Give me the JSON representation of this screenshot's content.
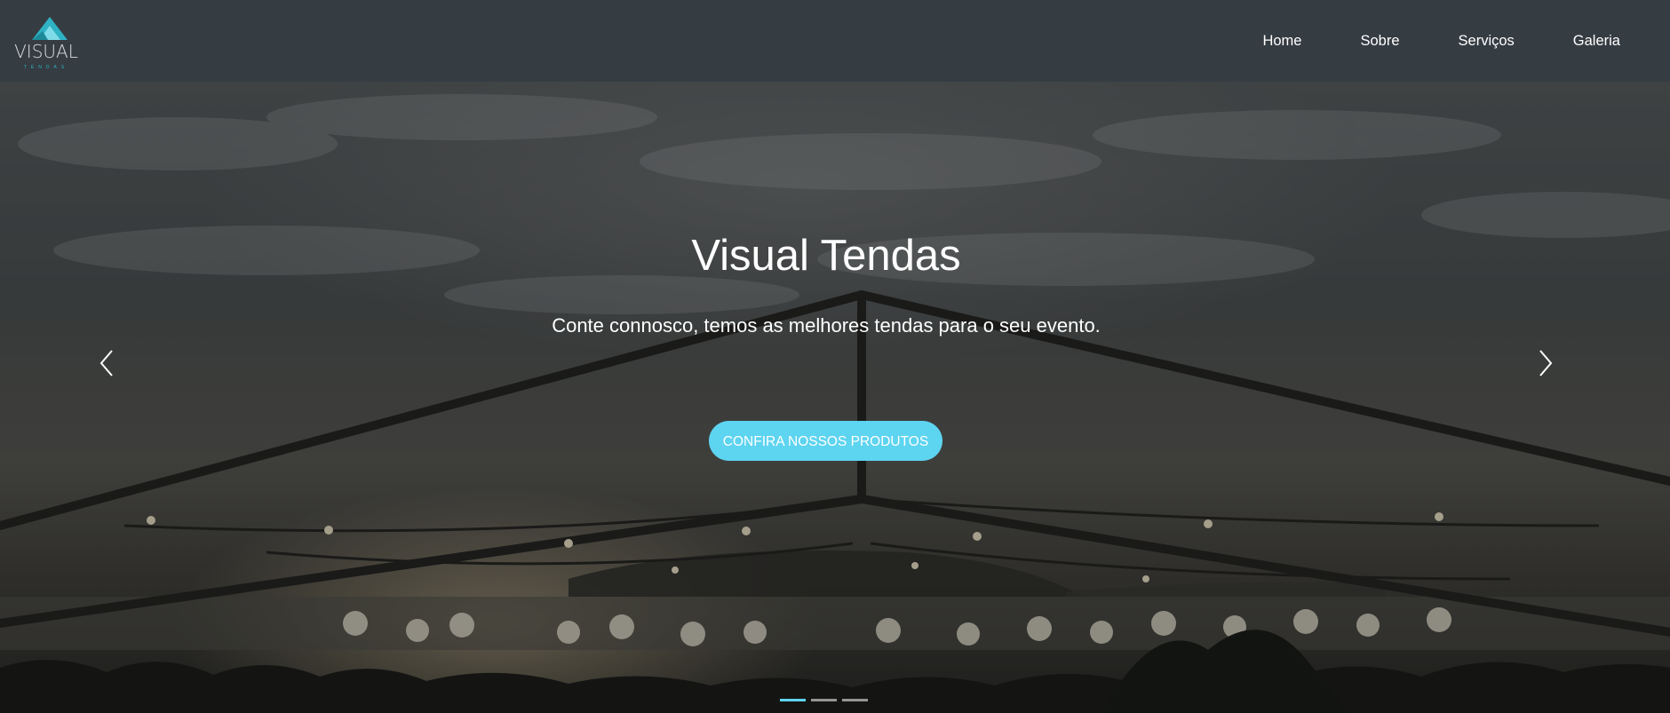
{
  "brand": {
    "name": "VISUAL",
    "tagline": "TENDAS",
    "accent_color": "#5dd4f0"
  },
  "nav": {
    "items": [
      {
        "label": "Home"
      },
      {
        "label": "Sobre"
      },
      {
        "label": "Serviços"
      },
      {
        "label": "Galeria"
      }
    ]
  },
  "hero": {
    "title": "Visual Tendas",
    "subtitle": "Conte connosco, temos as melhores tendas para o seu evento.",
    "cta_label": "CONFIRA NOSSOS PRODUTOS",
    "prev_icon": "chevron-left-icon",
    "next_icon": "chevron-right-icon",
    "slides_count": 3,
    "active_slide": 1
  }
}
